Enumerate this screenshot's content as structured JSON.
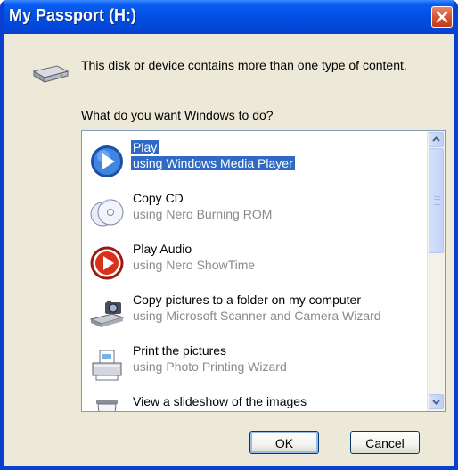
{
  "window": {
    "title": "My Passport (H:)"
  },
  "dialog": {
    "message": "This disk or device contains more than one type of content.",
    "question": "What do you want Windows to do?"
  },
  "options": [
    {
      "action": "Play",
      "program": "using Windows Media Player",
      "icon": "windows-media-player-icon",
      "selected": true
    },
    {
      "action": "Copy CD",
      "program": "using Nero Burning ROM",
      "icon": "cd-copy-icon",
      "selected": false
    },
    {
      "action": "Play Audio",
      "program": "using Nero ShowTime",
      "icon": "nero-showtime-icon",
      "selected": false
    },
    {
      "action": "Copy pictures to a folder on my computer",
      "program": "using Microsoft Scanner and Camera Wizard",
      "icon": "camera-scanner-icon",
      "selected": false
    },
    {
      "action": "Print the pictures",
      "program": "using Photo Printing Wizard",
      "icon": "printer-icon",
      "selected": false
    },
    {
      "action": "View a slideshow of the images",
      "program": "",
      "icon": "slideshow-icon",
      "selected": false
    }
  ],
  "buttons": {
    "ok": "OK",
    "cancel": "Cancel"
  },
  "colors": {
    "titlebar": "#0351e4",
    "selection": "#316ac5",
    "dialog_bg": "#ece9d8"
  }
}
